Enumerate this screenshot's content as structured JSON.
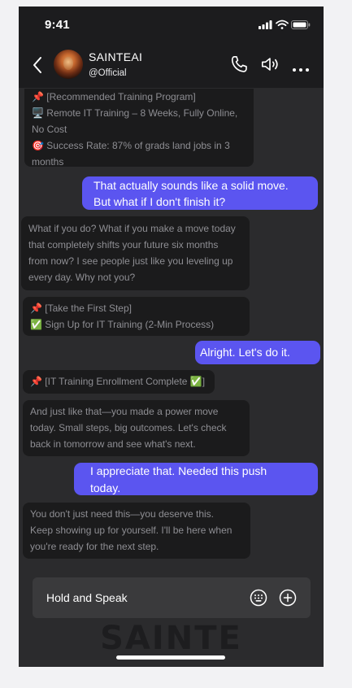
{
  "status": {
    "time": "9:41"
  },
  "header": {
    "name": "SAINTEAI",
    "handle": "@Official"
  },
  "messages": {
    "m1": {
      "lines": [
        "📌 [Recommended Training Program]",
        "🖥️ Remote IT Training – 8 Weeks, Fully Online,",
        "No Cost",
        "🎯 Success Rate: 87% of grads land jobs in 3",
        "months"
      ]
    },
    "m2": {
      "lines": [
        "That actually sounds like a solid move.",
        "But what if I don't finish it?"
      ]
    },
    "m3": {
      "lines": [
        "What if you do? What if you make a move today",
        "that completely shifts your future six months",
        "from now? I see people just like you leveling up",
        "every day. Why not you?"
      ]
    },
    "m4": {
      "lines": [
        "📌 [Take the First Step]",
        "✅ Sign Up for IT Training (2-Min Process)"
      ]
    },
    "m5": {
      "lines": [
        "Alright. Let's do it."
      ]
    },
    "m6": {
      "lines": [
        "📌 [IT Training Enrollment Complete ✅]"
      ]
    },
    "m7": {
      "lines": [
        "And just like that—you made a power move",
        "today. Small steps, big outcomes. Let's check",
        "back in tomorrow and see what's next."
      ]
    },
    "m8": {
      "lines": [
        "I appreciate that. Needed this push",
        "today."
      ]
    },
    "m9": {
      "lines": [
        "You don't just need this—you deserve this.",
        "Keep showing up for yourself. I'll be here when",
        "you're ready for the next step."
      ]
    }
  },
  "composer": {
    "hold_to_speak": "Hold and Speak"
  },
  "watermark": "SAINTE",
  "colors": {
    "accent": "#5b55f0",
    "background": "#2b2b2d",
    "bot_bubble": "#1b1b1c",
    "header": "#1c1c1e"
  }
}
